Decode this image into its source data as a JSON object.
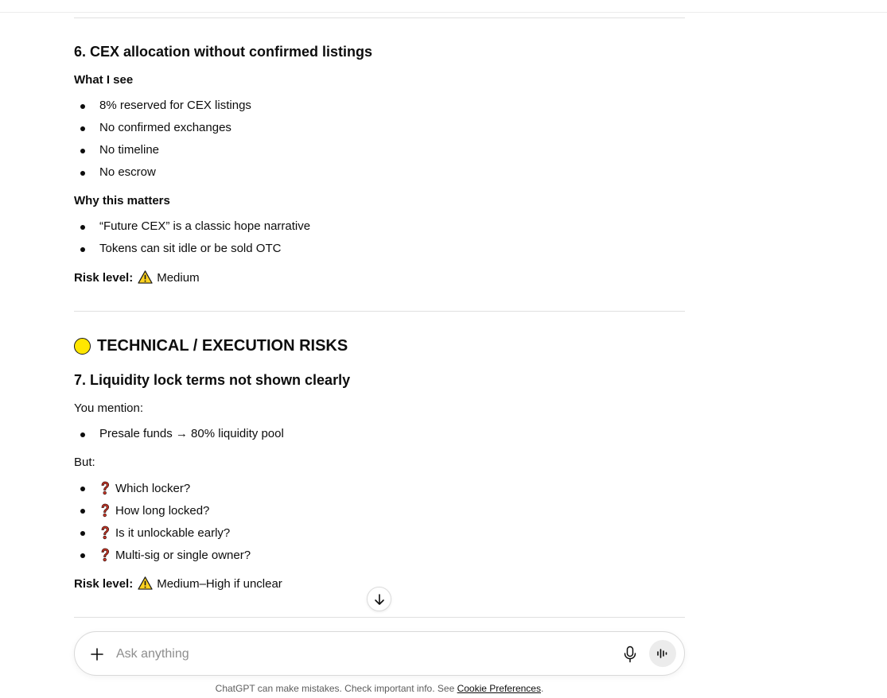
{
  "section6": {
    "heading": "6. CEX allocation without confirmed listings",
    "what_i_see_label": "What I see",
    "what_i_see": [
      "8% reserved for CEX listings",
      "No confirmed exchanges",
      "No timeline",
      "No escrow"
    ],
    "why_label": "Why this matters",
    "why": [
      "“Future CEX” is a classic hope narrative",
      "Tokens can sit idle or be sold OTC"
    ],
    "risk_label": "Risk level:",
    "risk_value": "Medium"
  },
  "tech_section": {
    "heading": "TECHNICAL / EXECUTION RISKS",
    "icon": "yellow-circle-icon",
    "color": "#ffe600"
  },
  "section7": {
    "heading": "7. Liquidity lock terms not shown clearly",
    "intro": "You mention:",
    "mentions": [
      "Presale funds → 80% liquidity pool"
    ],
    "but_label": "But:",
    "questions": [
      "Which locker?",
      "How long locked?",
      "Is it unlockable early?",
      "Multi-sig or single owner?"
    ],
    "risk_label": "Risk level:",
    "risk_value": "Medium–High if unclear"
  },
  "composer": {
    "placeholder": "Ask anything"
  },
  "footer": {
    "text": "ChatGPT can make mistakes. Check important info. See ",
    "link": "Cookie Preferences",
    "end": "."
  }
}
